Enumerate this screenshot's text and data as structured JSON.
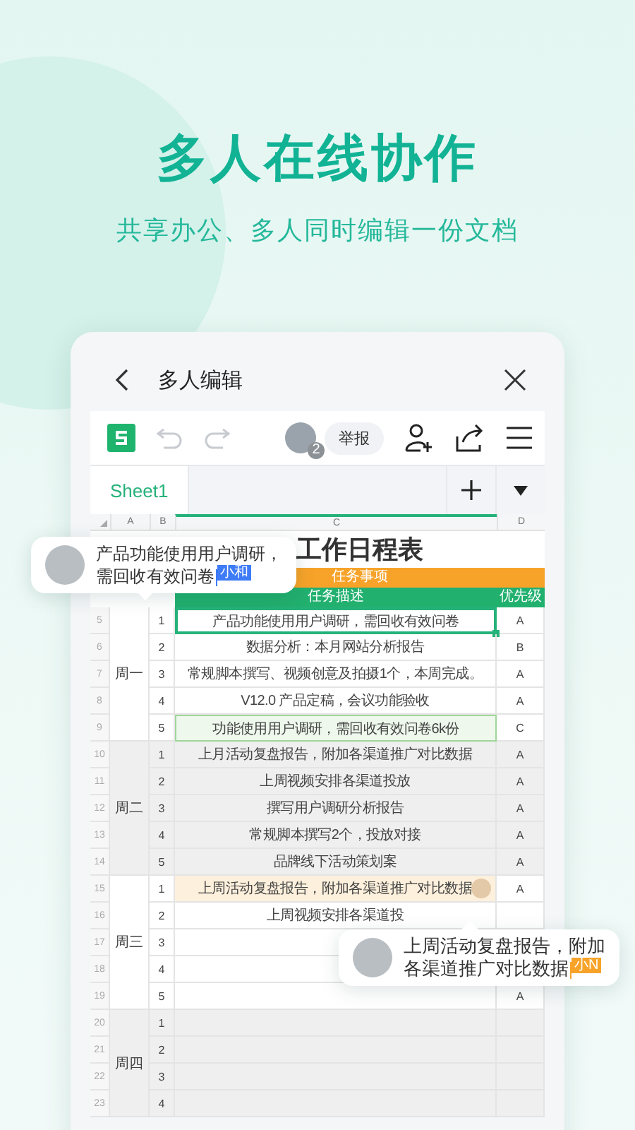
{
  "header": {
    "title": "多人在线协作",
    "subtitle": "共享办公、多人同时编辑一份文档"
  },
  "app": {
    "title": "多人编辑",
    "undo_disabled": true,
    "redo_disabled": true,
    "collaborator_count": "2",
    "report_button": "举报"
  },
  "sheet_tabs": [
    {
      "label": "Sheet1",
      "selected": true
    }
  ],
  "columns": [
    {
      "label": "A",
      "selected": false
    },
    {
      "label": "B",
      "selected": false
    },
    {
      "label": "C",
      "selected": true
    },
    {
      "label": "D",
      "selected": false
    }
  ],
  "sheet": {
    "title": "工作日程表",
    "section": "任务事项",
    "headers": [
      "任务描述",
      "优先级"
    ],
    "groups": [
      {
        "day": "周一",
        "shaded": false,
        "rows": [
          {
            "row_number": "5",
            "index": "1",
            "task": "产品功能使用用户调研，需回收有效问卷",
            "priority": "A",
            "kind": "selected"
          },
          {
            "row_number": "6",
            "index": "2",
            "task": "数据分析：本月网站分析报告",
            "priority": "B",
            "kind": "normal"
          },
          {
            "row_number": "7",
            "index": "3",
            "task": "常规脚本撰写、视频创意及拍摄1个，本周完成。",
            "priority": "A",
            "kind": "normal"
          },
          {
            "row_number": "8",
            "index": "4",
            "task": "V12.0 产品定稿，会议功能验收",
            "priority": "A",
            "kind": "normal"
          },
          {
            "row_number": "9",
            "index": "5",
            "task": "功能使用用户调研，需回收有效问卷6k份",
            "priority": "C",
            "kind": "green"
          }
        ]
      },
      {
        "day": "周二",
        "shaded": true,
        "rows": [
          {
            "row_number": "10",
            "index": "1",
            "task": "上月活动复盘报告，附加各渠道推广对比数据",
            "priority": "A",
            "kind": "normal"
          },
          {
            "row_number": "11",
            "index": "2",
            "task": "上周视频安排各渠道投放",
            "priority": "A",
            "kind": "normal"
          },
          {
            "row_number": "12",
            "index": "3",
            "task": "撰写用户调研分析报告",
            "priority": "A",
            "kind": "normal"
          },
          {
            "row_number": "13",
            "index": "4",
            "task": "常规脚本撰写2个，投放对接",
            "priority": "A",
            "kind": "normal"
          },
          {
            "row_number": "14",
            "index": "5",
            "task": "品牌线下活动策划案",
            "priority": "A",
            "kind": "normal"
          }
        ]
      },
      {
        "day": "周三",
        "shaded": false,
        "rows": [
          {
            "row_number": "15",
            "index": "1",
            "task": "上周活动复盘报告，附加各渠道推广对比数据",
            "priority": "A",
            "kind": "orange"
          },
          {
            "row_number": "16",
            "index": "2",
            "task": "上周视频安排各渠道投",
            "kind": "normal"
          },
          {
            "row_number": "17",
            "index": "3",
            "kind": "normal"
          },
          {
            "row_number": "18",
            "index": "4",
            "kind": "normal"
          },
          {
            "row_number": "19",
            "index": "5",
            "priority": "A",
            "kind": "normal"
          }
        ]
      },
      {
        "day": "周四",
        "shaded": true,
        "rows": [
          {
            "row_number": "20",
            "index": "1",
            "kind": "normal"
          },
          {
            "row_number": "21",
            "index": "2",
            "kind": "normal"
          },
          {
            "row_number": "22",
            "index": "3",
            "kind": "normal"
          },
          {
            "row_number": "23",
            "index": "4",
            "kind": "normal"
          }
        ]
      }
    ]
  },
  "comments": [
    {
      "text": "产品功能使用用户调研，需回收有效问卷",
      "badge": "小和",
      "color": "#3d7bf7"
    },
    {
      "text": "上周活动复盘报告，附加各渠道推广对比数据",
      "badge": "小N",
      "color": "#f7a32a"
    }
  ]
}
